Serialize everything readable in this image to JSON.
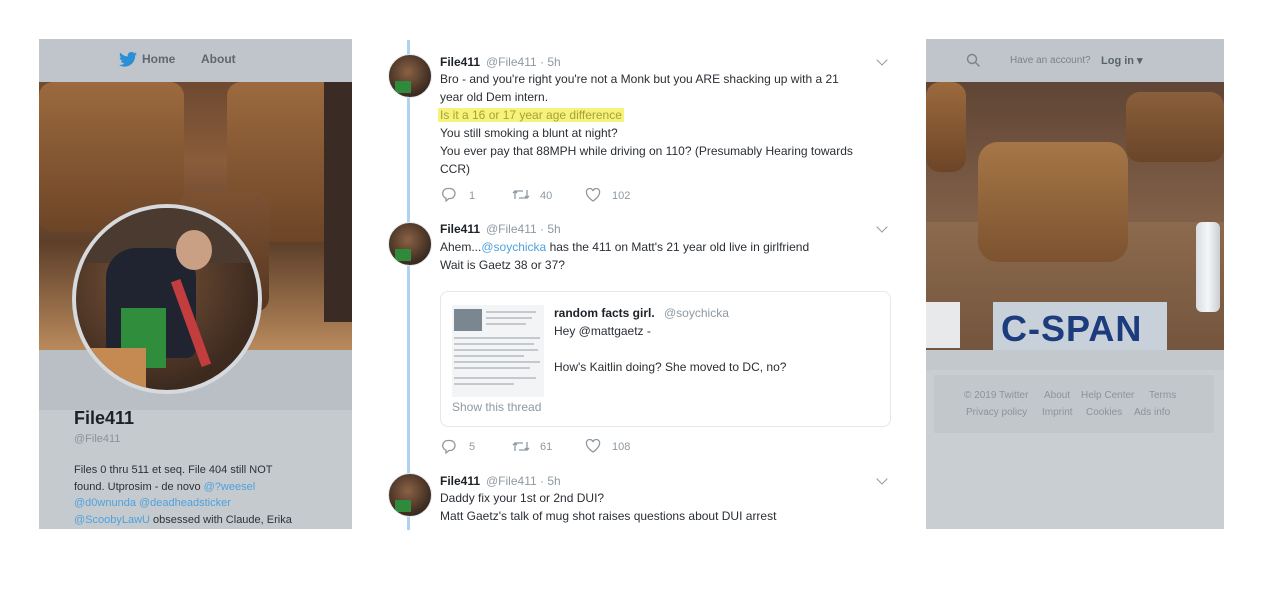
{
  "left": {
    "nav": {
      "home": "Home",
      "about": "About"
    },
    "profile": {
      "name": "File411",
      "handle": "@File411",
      "bio_line1": "Files 0 thru 511 et seq. File 404 still NOT",
      "bio_line2_text": "found. Utprosim - de novo ",
      "bio_line2_link": "@?weesel",
      "bio_line3": "@d0wnunda @deadheadsticker",
      "bio_line4_link": "@ScoobyLawU",
      "bio_line4_text": " obsessed with Claude, Erika"
    }
  },
  "tweets": [
    {
      "name": "File411",
      "meta": "@File411 · 5h",
      "line1": "Bro - and you're right you're not a Monk but you ARE shacking up with a 21",
      "line2": "year old Dem intern.",
      "highlight": "Is it a 16 or 17 year age difference",
      "line4": "You still smoking a blunt at night?",
      "line5": "You ever pay that 88MPH while driving on 110? (Presumably Hearing towards",
      "line6": "CCR)",
      "replies": "1",
      "retweets": "40",
      "likes": "102"
    },
    {
      "name": "File411",
      "meta": "@File411 · 5h",
      "line1_pre": "Ahem...",
      "line1_mention": "@soychicka",
      "line1_post": " has the 411 on Matt's 21 year old live in girlfriend",
      "line2": "Wait is Gaetz 38 or 37?",
      "quote": {
        "name": "random facts girl.",
        "handle": "@soychicka",
        "line1": "Hey @mattgaetz -",
        "line2": "How's Kaitlin doing?  She moved to DC, no?",
        "show_thread": "Show this thread"
      },
      "replies": "5",
      "retweets": "61",
      "likes": "108"
    },
    {
      "name": "File411",
      "meta": "@File411 · 5h",
      "line1": "Daddy fix your 1st or 2nd DUI?",
      "line2": "Matt Gaetz's talk of mug shot raises questions about DUI arrest"
    }
  ],
  "right": {
    "nav": {
      "have_account": "Have an account?",
      "login": "Log in ▾"
    },
    "logo": "C-SPAN",
    "footer": {
      "row1": [
        "© 2019 Twitter",
        "About",
        "Help Center",
        "Terms"
      ],
      "row2": [
        "Privacy policy",
        "Imprint",
        "Cookies",
        "Ads info"
      ]
    }
  },
  "colors": {
    "link": "#4ea2df",
    "highlight": "#f7f27a",
    "thread_line": "#aed2ef",
    "twitter_blue": "#1da1f2"
  },
  "icons": [
    "twitter-bird-icon",
    "search-icon",
    "reply-icon",
    "retweet-icon",
    "like-icon",
    "chevron-down-icon"
  ]
}
